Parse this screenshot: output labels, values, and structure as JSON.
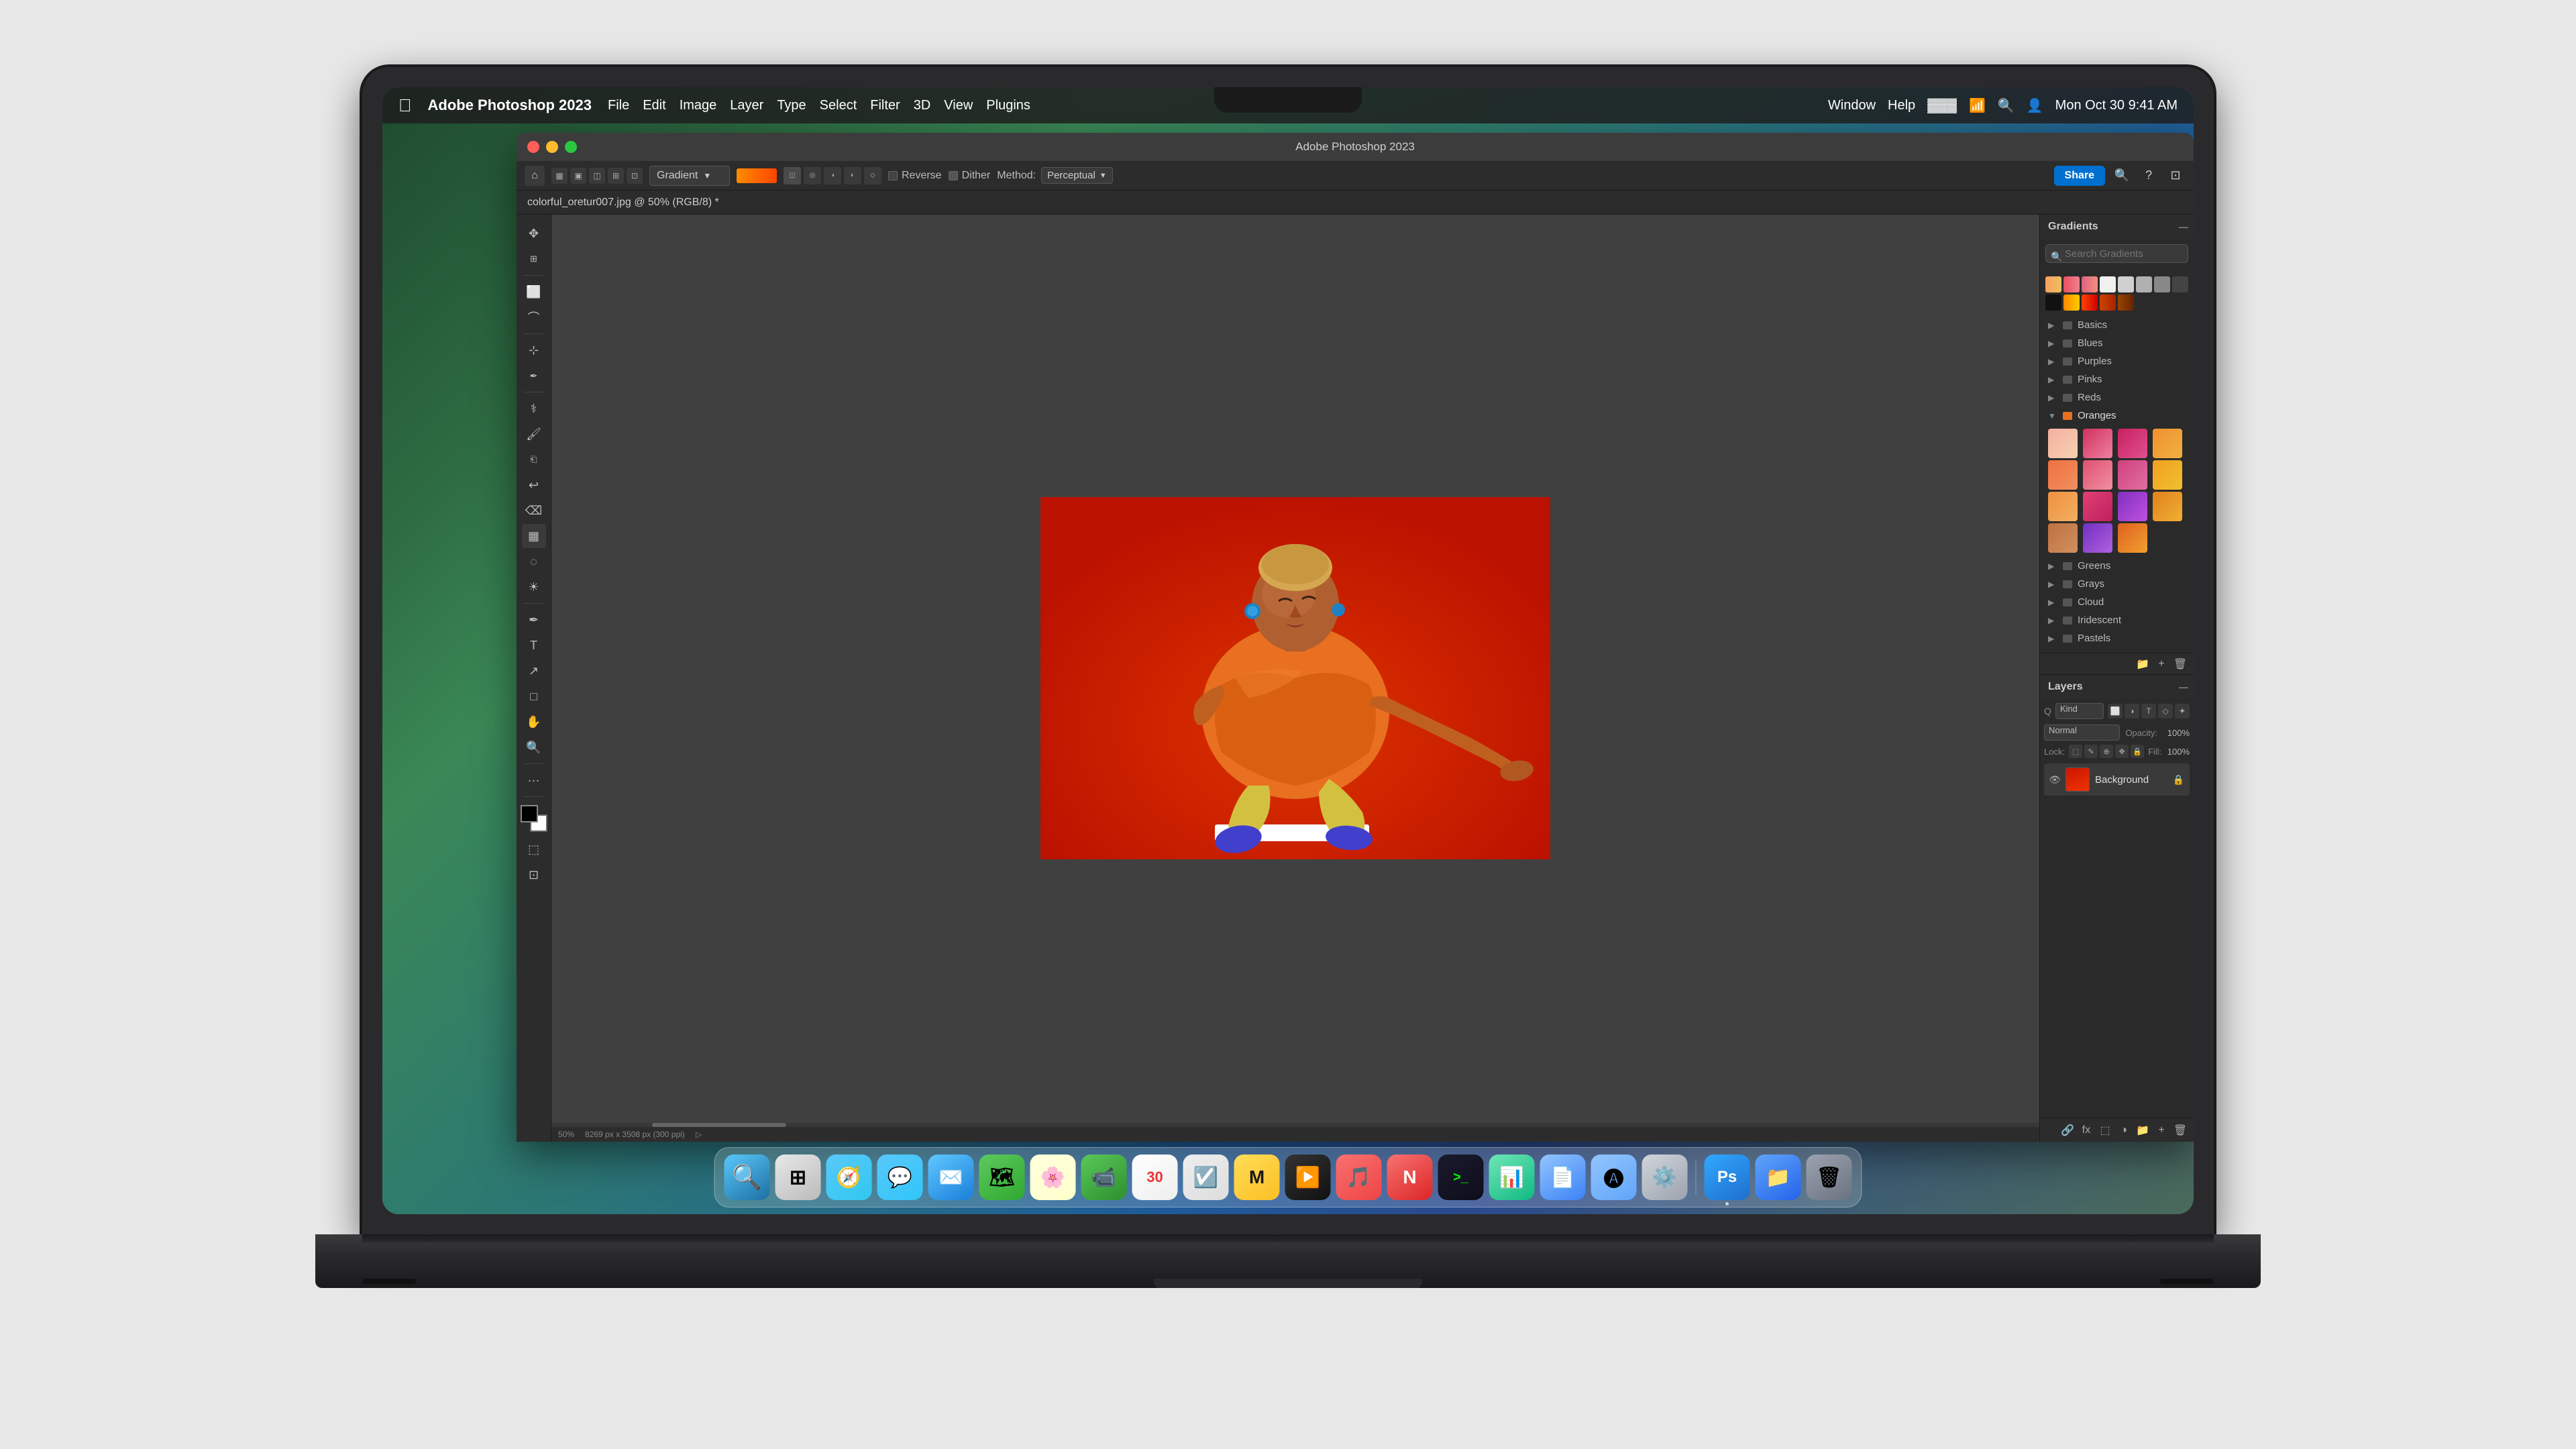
{
  "window": {
    "title": "Adobe Photoshop 2023",
    "document_title": "colorful_oretur007.jpg @ 50% (RGB/8) *"
  },
  "menubar": {
    "apple": "⌘",
    "app_name": "Adobe Photoshop 2023",
    "items": [
      "File",
      "Edit",
      "Image",
      "Layer",
      "Type",
      "Select",
      "Filter",
      "3D",
      "View",
      "Plugins"
    ],
    "right_items": [
      "Window",
      "Help"
    ],
    "date": "Mon Oct 30",
    "time": "9:41 AM"
  },
  "toolbar": {
    "home_icon": "⌂",
    "gradient_label": "Gradient",
    "reverse_label": "Reverse",
    "dither_label": "Dither",
    "method_label": "Method:",
    "method_value": "Perceptual",
    "share_label": "Share"
  },
  "gradients_panel": {
    "title": "Gradients",
    "search_placeholder": "Search Gradients",
    "categories": [
      {
        "name": "Basics",
        "open": false
      },
      {
        "name": "Blues",
        "open": false
      },
      {
        "name": "Purples",
        "open": false
      },
      {
        "name": "Pinks",
        "open": false
      },
      {
        "name": "Reds",
        "open": false
      },
      {
        "name": "Oranges",
        "open": true
      },
      {
        "name": "Greens",
        "open": false
      },
      {
        "name": "Grays",
        "open": false
      },
      {
        "name": "Cloud",
        "open": false
      },
      {
        "name": "Iridescent",
        "open": false
      },
      {
        "name": "Pastels",
        "open": false
      }
    ],
    "oranges_swatches": [
      {
        "color": "#f5a58a",
        "color2": "#f5c5a0"
      },
      {
        "color": "#e05060",
        "color2": "#f08090"
      },
      {
        "color": "#d03060",
        "color2": "#e06090"
      },
      {
        "color": "#f08020",
        "color2": "#f0a040"
      },
      {
        "color": "#f07030",
        "color2": "#f09050"
      },
      {
        "color": "#e86070",
        "color2": "#f090a0"
      },
      {
        "color": "#e06080",
        "color2": "#f09080"
      },
      {
        "color": "#f0a020",
        "color2": "#f0c030"
      },
      {
        "color": "#f09030",
        "color2": "#f0b050"
      },
      {
        "color": "#e85070",
        "color2": "#d03060"
      },
      {
        "color": "#9030c0",
        "color2": "#c040e0"
      },
      {
        "color": "#e08020",
        "color2": "#f0b030"
      },
      {
        "color": "#c07040",
        "color2": "#d09050"
      },
      {
        "color": "#8040c0",
        "color2": "#c070e0"
      },
      {
        "color": "#e06020",
        "color2": "#f0a030"
      }
    ]
  },
  "layers_panel": {
    "title": "Layers",
    "filter_kind": "Kind",
    "blend_mode": "Normal",
    "opacity_label": "Opacity:",
    "opacity_value": "100%",
    "lock_label": "Lock:",
    "fill_label": "Fill:",
    "fill_value": "100%",
    "layers": [
      {
        "name": "Background",
        "visible": true,
        "locked": true
      }
    ]
  },
  "status_bar": {
    "zoom": "50%",
    "dimensions": "8269 px x 3508 px (300 ppi)"
  },
  "dock": {
    "apps": [
      {
        "name": "Finder",
        "class": "dock-finder",
        "icon": "🔍",
        "active": false
      },
      {
        "name": "Launchpad",
        "class": "dock-launchpad",
        "icon": "◉",
        "active": false
      },
      {
        "name": "Safari",
        "class": "dock-safari",
        "icon": "◎",
        "active": false
      },
      {
        "name": "Messages",
        "class": "dock-messages",
        "icon": "💬",
        "active": false
      },
      {
        "name": "Mail",
        "class": "dock-mail",
        "icon": "✉",
        "active": false
      },
      {
        "name": "Maps",
        "class": "dock-maps",
        "icon": "📍",
        "active": false
      },
      {
        "name": "Photos",
        "class": "dock-photos",
        "icon": "🌸",
        "active": false
      },
      {
        "name": "FaceTime",
        "class": "dock-facetime",
        "icon": "📹",
        "active": false
      },
      {
        "name": "Calendar",
        "class": "dock-calendar",
        "icon": "30",
        "active": false
      },
      {
        "name": "Reminders",
        "class": "dock-reminders",
        "icon": "☑",
        "active": false
      },
      {
        "name": "Miro",
        "class": "dock-miro",
        "icon": "M",
        "active": false
      },
      {
        "name": "Apple TV",
        "class": "dock-appletv",
        "icon": "▶",
        "active": false
      },
      {
        "name": "Music",
        "class": "dock-music",
        "icon": "♪",
        "active": false
      },
      {
        "name": "News",
        "class": "dock-news",
        "icon": "N",
        "active": false
      },
      {
        "name": "Terminal",
        "class": "dock-terminal",
        "icon": ">_",
        "active": false
      },
      {
        "name": "Numbers",
        "class": "dock-numbers",
        "icon": "#",
        "active": false
      },
      {
        "name": "Pages",
        "class": "dock-pages",
        "icon": "P",
        "active": false
      },
      {
        "name": "App Store",
        "class": "dock-appstore",
        "icon": "A",
        "active": false
      },
      {
        "name": "System Settings",
        "class": "dock-settings",
        "icon": "⚙",
        "active": false
      },
      {
        "name": "Photoshop",
        "class": "dock-ps",
        "icon": "Ps",
        "active": true
      },
      {
        "name": "Folder",
        "class": "dock-folder",
        "icon": "📁",
        "active": false
      },
      {
        "name": "Trash",
        "class": "dock-trash",
        "icon": "🗑",
        "active": false
      }
    ]
  }
}
